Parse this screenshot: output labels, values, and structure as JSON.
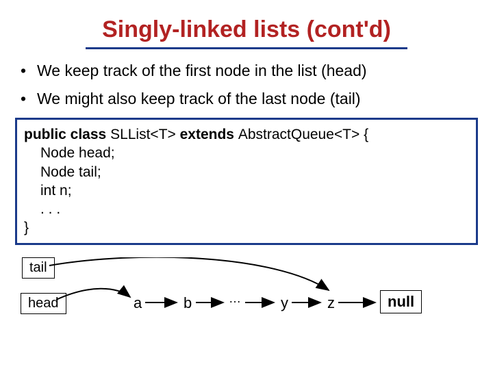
{
  "title": "Singly-linked lists (cont'd)",
  "bullets": [
    "We keep track of the first node in the list (head)",
    "We might also keep track of the last node (tail)"
  ],
  "code": {
    "line1_pre": "public class ",
    "line1_mid": "SLList<T> ",
    "line1_kw2": "extends ",
    "line1_post": "AbstractQueue<T> {",
    "line2": "Node head;",
    "line3": "Node tail;",
    "line4": "int n;",
    "line5": ". . .",
    "line6": "}"
  },
  "diagram": {
    "tail": "tail",
    "head": "head",
    "nodes": {
      "a": "a",
      "b": "b",
      "dots": "…",
      "y": "y",
      "z": "z"
    },
    "null": "null"
  }
}
